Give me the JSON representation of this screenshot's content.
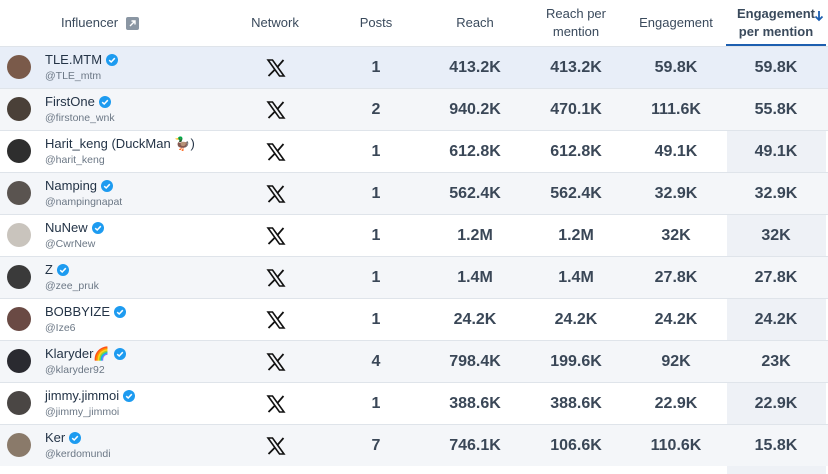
{
  "colors": {
    "accent": "#1d5fb0",
    "verified": "#1d9bf0",
    "row_alt": "#f4f6f9",
    "highlight_col": "#eef1f6"
  },
  "header": {
    "influencer": "Influencer",
    "influencer_icon": "external-link-icon",
    "network": "Network",
    "posts": "Posts",
    "reach": "Reach",
    "reach_per_mention_1": "Reach per",
    "reach_per_mention_2": "mention",
    "engagement": "Engagement",
    "engagement_per_mention_1": "Engagement",
    "engagement_per_mention_2": "per mention",
    "sort_icon": "arrow-down-icon"
  },
  "rows": [
    {
      "name": "TLE.MTM",
      "handle": "@TLE_mtm",
      "verified": true,
      "network": "x-icon",
      "posts": "1",
      "reach": "413.2K",
      "rpm": "413.2K",
      "eng": "59.8K",
      "epm": "59.8K"
    },
    {
      "name": "FirstOne",
      "handle": "@firstone_wnk",
      "verified": true,
      "network": "x-icon",
      "posts": "2",
      "reach": "940.2K",
      "rpm": "470.1K",
      "eng": "111.6K",
      "epm": "55.8K"
    },
    {
      "name": "Harit_keng (DuckMan 🦆)",
      "handle": "@harit_keng",
      "verified": false,
      "network": "x-icon",
      "posts": "1",
      "reach": "612.8K",
      "rpm": "612.8K",
      "eng": "49.1K",
      "epm": "49.1K"
    },
    {
      "name": "Namping",
      "handle": "@nampingnapat",
      "verified": true,
      "network": "x-icon",
      "posts": "1",
      "reach": "562.4K",
      "rpm": "562.4K",
      "eng": "32.9K",
      "epm": "32.9K"
    },
    {
      "name": "NuNew",
      "handle": "@CwrNew",
      "verified": true,
      "network": "x-icon",
      "posts": "1",
      "reach": "1.2M",
      "rpm": "1.2M",
      "eng": "32K",
      "epm": "32K"
    },
    {
      "name": "Z",
      "handle": "@zee_pruk",
      "verified": true,
      "network": "x-icon",
      "posts": "1",
      "reach": "1.4M",
      "rpm": "1.4M",
      "eng": "27.8K",
      "epm": "27.8K"
    },
    {
      "name": "BOBBYIZE",
      "handle": "@Ize6",
      "verified": true,
      "network": "x-icon",
      "posts": "1",
      "reach": "24.2K",
      "rpm": "24.2K",
      "eng": "24.2K",
      "epm": "24.2K"
    },
    {
      "name": "Klaryder🌈",
      "handle": "@klaryder92",
      "verified": true,
      "network": "x-icon",
      "posts": "4",
      "reach": "798.4K",
      "rpm": "199.6K",
      "eng": "92K",
      "epm": "23K"
    },
    {
      "name": "jimmy.jimmoi",
      "handle": "@jimmy_jimmoi",
      "verified": true,
      "network": "x-icon",
      "posts": "1",
      "reach": "388.6K",
      "rpm": "388.6K",
      "eng": "22.9K",
      "epm": "22.9K"
    },
    {
      "name": "Ker",
      "handle": "@kerdomundi",
      "verified": true,
      "network": "x-icon",
      "posts": "7",
      "reach": "746.1K",
      "rpm": "106.6K",
      "eng": "110.6K",
      "epm": "15.8K"
    }
  ]
}
